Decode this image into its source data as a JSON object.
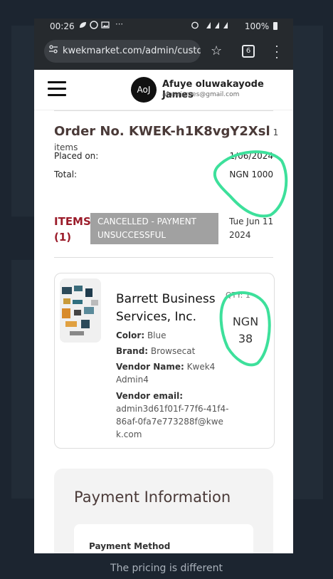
{
  "colors": {
    "accent": "#9b1c2a",
    "annotation": "#3de09b",
    "badge": "#a1a1a1",
    "page_bg": "#1c2530"
  },
  "caption": "The pricing is different",
  "status_bar": {
    "time": "00:26",
    "icons_left": [
      "leaf-icon",
      "whatsapp-icon",
      "gallery-icon",
      "more-icon"
    ],
    "icons_left_glyph": "⋯",
    "right_text": "100%",
    "icons_right": [
      "alarm-icon",
      "mute-icon",
      "signal-icon",
      "battery-icon"
    ]
  },
  "browser": {
    "url": "kwekmarket.com/admin/custom",
    "tab_count": "6"
  },
  "header": {
    "avatar_initials": "AoJ",
    "user_name": "Afuye oluwakayode James",
    "user_email": "afuyejames@gmail.com"
  },
  "order": {
    "title": "Order No. KWEK-h1K8vgY2Xsl",
    "items_count": "1 items",
    "placed_on_label": "Placed on:",
    "placed_on_value": "1/06/2024",
    "total_label": "Total:",
    "total_value": "NGN 1000",
    "items_label_1": "ITEMS",
    "items_label_2": "(1)",
    "status_line_1": "CANCELLED - PAYMENT",
    "status_line_2": "UNSUCCESSFUL",
    "date_line_1": "Tue Jun 11",
    "date_line_2": "2024"
  },
  "product": {
    "name": "Barrett Business Services, Inc.",
    "qty": "QTY: 1",
    "price_line_1": "NGN",
    "price_line_2": "38",
    "color_label": "Color:",
    "color_value": "Blue",
    "brand_label": "Brand:",
    "brand_value": "Browsecat",
    "vendor_name_label": "Vendor Name:",
    "vendor_name_value": "Kwek4 Admin4",
    "vendor_email_label": "Vendor email:",
    "vendor_email_value": "admin3d61f01f-77f6-41f4-86af-0fa7e773288f@kwek.com"
  },
  "payment": {
    "title": "Payment Information",
    "method_label": "Payment Method"
  }
}
